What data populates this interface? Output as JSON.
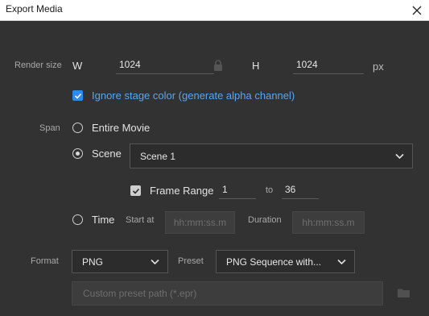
{
  "window": {
    "title": "Export Media"
  },
  "render_size": {
    "label": "Render size",
    "w_label": "W",
    "width": "1024",
    "h_label": "H",
    "height": "1024",
    "unit": "px"
  },
  "ignore_stage": {
    "label": "Ignore stage color (generate alpha channel)",
    "checked": true
  },
  "span": {
    "label": "Span",
    "entire_movie": "Entire Movie",
    "scene_label": "Scene",
    "scene_value": "Scene 1",
    "frame_range_label": "Frame Range",
    "frame_from": "1",
    "to_label": "to",
    "frame_to": "36",
    "time_label": "Time",
    "start_at_label": "Start at",
    "start_at_placeholder": "hh:mm:ss.m",
    "duration_label": "Duration",
    "duration_placeholder": "hh:mm:ss.m"
  },
  "format": {
    "label": "Format",
    "value": "PNG",
    "preset_label": "Preset",
    "preset_value": "PNG Sequence with..."
  },
  "custom_preset": {
    "placeholder": "Custom preset path (*.epr)"
  },
  "colors": {
    "accent": "#2d8ceb",
    "link": "#5aa5f0",
    "background": "#323232"
  }
}
